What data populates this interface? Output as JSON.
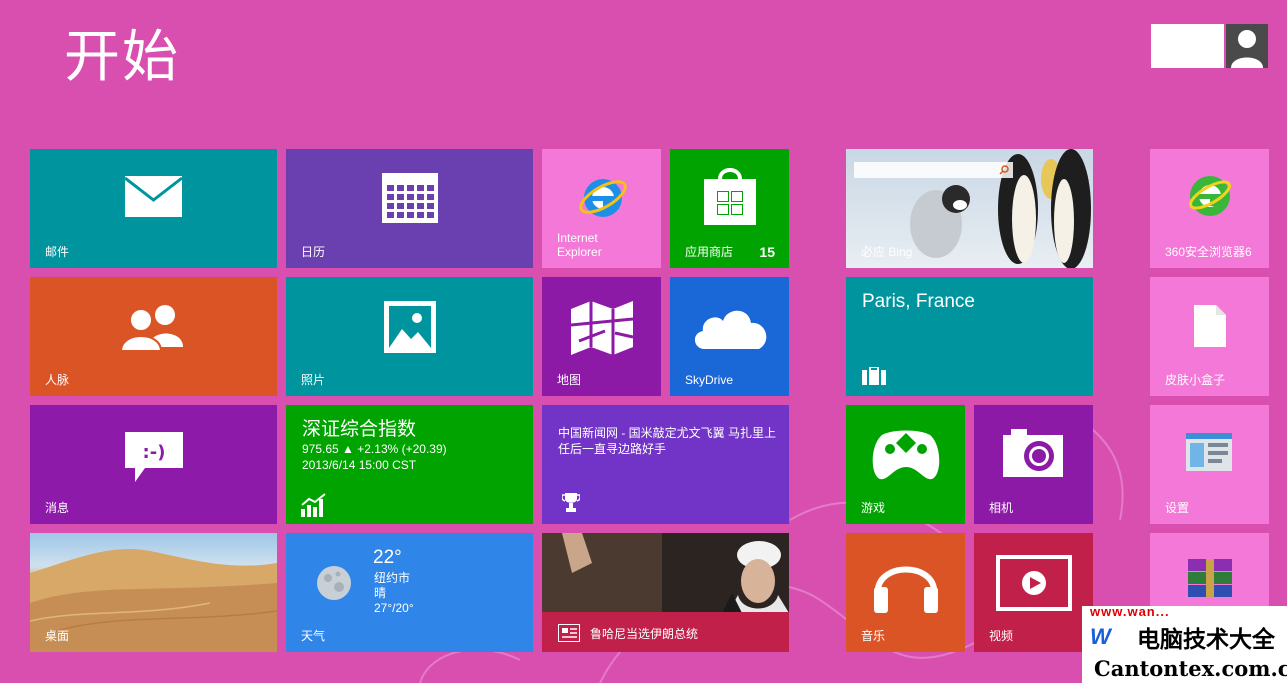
{
  "header": {
    "title": "开始"
  },
  "colors": {
    "background": "#d94fb0",
    "mail": "#00959e",
    "calendar": "#6a3fb0",
    "ie": "#f478d7",
    "store": "#00a300",
    "people": "#db5426",
    "photos": "#00959e",
    "maps": "#8c1aa7",
    "skydrive": "#1a67d8",
    "messaging": "#8d1aa8",
    "finance": "#00a300",
    "news": "#7134c6",
    "travel": "#00959e",
    "games": "#00a300",
    "camera": "#8c1aa7",
    "music": "#db5426",
    "video": "#c0204a",
    "weather": "#2f86e8",
    "sports": "#c0204a"
  },
  "tiles": {
    "mail": {
      "label": "邮件",
      "icon": "mail-icon"
    },
    "calendar": {
      "label": "日历",
      "icon": "calendar-icon"
    },
    "ie": {
      "label": "Internet Explorer",
      "icon": "internet-explorer-icon"
    },
    "store": {
      "label": "应用商店",
      "badge": "15",
      "icon": "store-bag-icon"
    },
    "bing": {
      "label": "必应 Bing"
    },
    "browser360": {
      "label": "360安全浏览器6",
      "icon": "browser-360-icon"
    },
    "people": {
      "label": "人脉",
      "icon": "people-icon"
    },
    "photos": {
      "label": "照片",
      "icon": "picture-icon"
    },
    "maps": {
      "label": "地图",
      "icon": "map-icon"
    },
    "skydrive": {
      "label": "SkyDrive",
      "icon": "cloud-icon"
    },
    "travel": {
      "title": "Paris, France",
      "icon": "suitcase-icon"
    },
    "skinbox": {
      "label": "皮肤小盒子",
      "icon": "document-icon"
    },
    "messaging": {
      "label": "消息",
      "icon": "chat-bubble-icon"
    },
    "finance": {
      "title": "深证综合指数",
      "line1": "975.65  ▲ +2.13% (+20.39)",
      "line2": "2013/6/14 15:00 CST",
      "icon": "chart-icon"
    },
    "news": {
      "text": "中国新闻网 - 国米敲定尤文飞翼 马扎里上任后一直寻边路好手",
      "icon": "trophy-icon"
    },
    "games": {
      "label": "游戏",
      "icon": "xbox-controller-icon"
    },
    "camera": {
      "label": "相机",
      "icon": "camera-icon"
    },
    "settings": {
      "label": "设置",
      "icon": "settings-window-icon"
    },
    "desktop": {
      "label": "桌面"
    },
    "weather": {
      "label": "天气",
      "temp": "22°",
      "city": "纽约市",
      "condition": "晴",
      "range": "27°/20°",
      "icon": "moon-icon"
    },
    "newsphoto": {
      "caption": "鲁哈尼当选伊朗总统",
      "icon": "newspaper-icon"
    },
    "music": {
      "label": "音乐",
      "icon": "headphones-icon"
    },
    "video": {
      "label": "视频",
      "icon": "video-play-icon"
    },
    "winrar": {
      "icon": "winrar-books-icon"
    }
  },
  "watermark": {
    "url_top": "www.wan...",
    "cn": "电脑技术大全",
    "en": "Cantontex.com.cn",
    "logo": "W"
  }
}
